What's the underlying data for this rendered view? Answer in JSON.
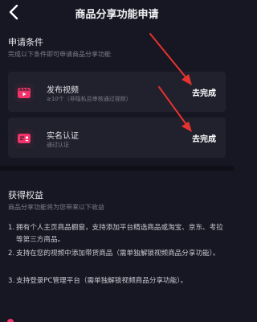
{
  "nav": {
    "title": "商品分享功能申请"
  },
  "requirements": {
    "title": "申请条件",
    "subtitle": "完成以下条件即可申请商品分享功能",
    "items": [
      {
        "title": "发布视频",
        "desc": "≥10个（非隐私且审核通过视频）",
        "action": "去完成",
        "icon": "video-icon",
        "icon_color": "#f2336a"
      },
      {
        "title": "实名认证",
        "desc": "通过认证",
        "action": "去完成",
        "icon": "id-card-icon",
        "icon_color": "#f2336a"
      }
    ]
  },
  "benefits": {
    "title": "获得权益",
    "subtitle": "商品分享功能将为您带来以下收益",
    "items": [
      {
        "num": "1.",
        "text": "拥有个人主页商品橱窗，支持添加平台精选商品或淘宝、京东、考拉等第三方商品。"
      },
      {
        "num": "2.",
        "text": "支持在您的视频中添加带货商品（需单独解锁视频商品分享功能）。"
      },
      {
        "num": "3.",
        "text": "支持登录PC管理平台（需单独解锁视频商品分享功能）。"
      }
    ]
  },
  "colors": {
    "background": "#161722",
    "card": "#20212d",
    "accent": "#f2336a",
    "annotation_arrow": "#e8322f"
  }
}
